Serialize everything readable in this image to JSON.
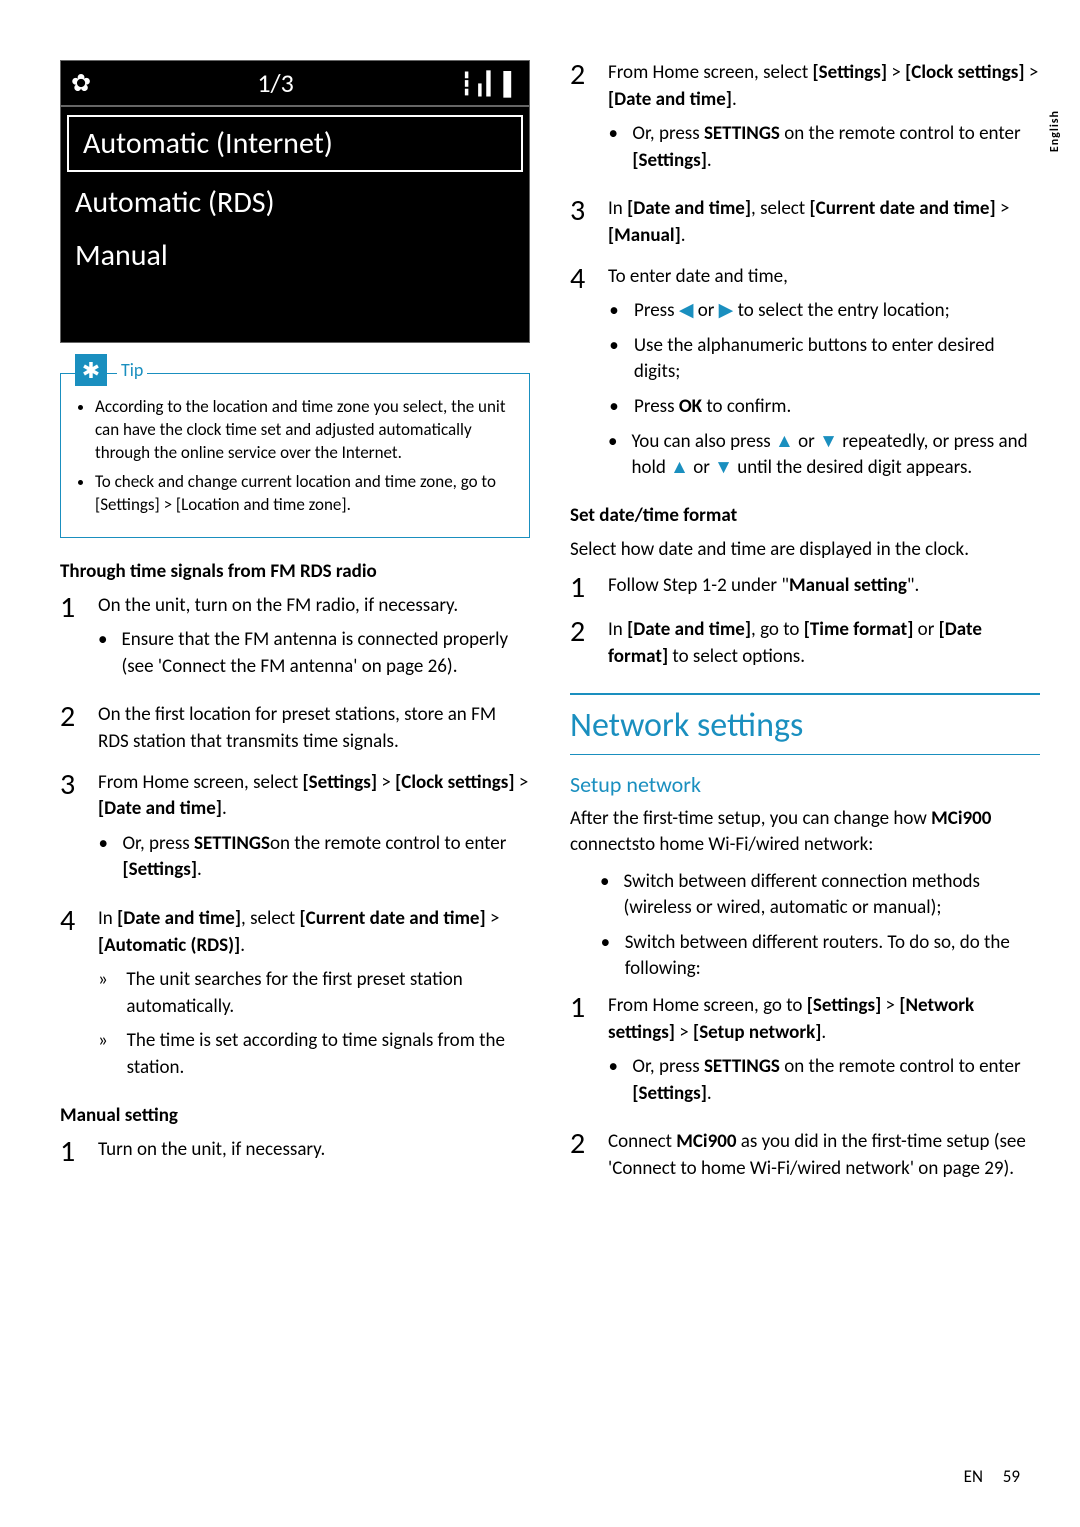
{
  "device": {
    "counter": "1/3",
    "items": [
      "Automatic (Internet)",
      "Automatic (RDS)",
      "Manual"
    ]
  },
  "tip": {
    "label": "Tip",
    "items": [
      "According to the location and time zone you select, the unit can have the clock time set and adjusted automatically through the online service over the Internet.",
      "To check and change current location and time zone, go to [Settings] > [Location and time zone]."
    ]
  },
  "left": {
    "rds_heading": "Through time signals from FM RDS radio",
    "rds_steps": {
      "s1": "On the unit, turn on the FM radio, if necessary.",
      "s1_sub": "Ensure that the FM antenna is connected properly  (see 'Connect the FM antenna' on page 26).",
      "s2": "On the first location for preset stations, store an FM RDS station that transmits time signals.",
      "s3_a": "From Home screen, select ",
      "s3_b": "[Settings]",
      "s3_c": " > ",
      "s3_d": "[Clock settings]",
      "s3_e": " > ",
      "s3_f": "[Date and time]",
      "s3_g": ".",
      "s3_sub_a": "Or, press ",
      "s3_sub_b": "SETTINGS",
      "s3_sub_c": "on the remote control to enter ",
      "s3_sub_d": "[Settings]",
      "s3_sub_e": ".",
      "s4_a": "In ",
      "s4_b": "[Date and time]",
      "s4_c": ", select ",
      "s4_d": "[Current date and time]",
      "s4_e": " > ",
      "s4_f": "[Automatic (RDS)]",
      "s4_g": ".",
      "s4_r1": "The unit searches for the first preset station automatically.",
      "s4_r2": "The time is set according to time signals from the station."
    },
    "manual_heading": "Manual setting",
    "manual_s1": "Turn on the unit, if necessary."
  },
  "right": {
    "s2_a": "From Home screen, select ",
    "s2_b": "[Settings]",
    "s2_c": " > ",
    "s2_d": "[Clock settings]",
    "s2_e": " >",
    "s2_f": "[Date and time]",
    "s2_g": ".",
    "s2_sub_a": "Or, press ",
    "s2_sub_b": "SETTINGS",
    "s2_sub_c": " on the remote control to enter ",
    "s2_sub_d": "[Settings]",
    "s2_sub_e": ".",
    "s3_a": "In ",
    "s3_b": "[Date and time]",
    "s3_c": ", select ",
    "s3_d": "[Current date and time]",
    "s3_e": " > ",
    "s3_f": "[Manual]",
    "s3_g": ".",
    "s4": "To enter date and time,",
    "s4_b1_a": "Press ",
    "s4_b1_b": " or ",
    "s4_b1_c": " to select the entry location;",
    "s4_b2": "Use the alphanumeric buttons to enter desired digits;",
    "s4_b3_a": "Press ",
    "s4_b3_b": "OK",
    "s4_b3_c": " to confirm.",
    "s4_b4_a": "You can also press ",
    "s4_b4_b": " or ",
    "s4_b4_c": " repeatedly, or press and hold ",
    "s4_b4_d": " or ",
    "s4_b4_e": " until the desired digit appears.",
    "fmt_heading": "Set date/time format",
    "fmt_para": "Select how date and time are displayed in the clock.",
    "fmt_s1_a": "Follow Step 1-2 under \"",
    "fmt_s1_b": "Manual setting",
    "fmt_s1_c": "\".",
    "fmt_s2_a": "In ",
    "fmt_s2_b": "[Date and time]",
    "fmt_s2_c": ", go to ",
    "fmt_s2_d": "[Time format]",
    "fmt_s2_e": " or ",
    "fmt_s2_f": "[Date format]",
    "fmt_s2_g": " to select options.",
    "net_heading": "Network settings",
    "net_sub": "Setup network",
    "net_para_a": "After the first-time setup, you can change how ",
    "net_para_b": "MCi900",
    "net_para_c": " connectsto home Wi-Fi/wired network:",
    "net_b1": "Switch between different connection methods (wireless or wired, automatic or manual);",
    "net_b2": "Switch between different routers. To do so, do the following:",
    "net_s1_a": "From Home screen, go to ",
    "net_s1_b": "[Settings]",
    "net_s1_c": " > ",
    "net_s1_d": "[Network settings]",
    "net_s1_e": " > ",
    "net_s1_f": "[Setup network]",
    "net_s1_g": ".",
    "net_s1_sub_a": "Or, press ",
    "net_s1_sub_b": "SETTINGS",
    "net_s1_sub_c": " on the remote control to enter ",
    "net_s1_sub_d": "[Settings]",
    "net_s1_sub_e": ".",
    "net_s2_a": "Connect ",
    "net_s2_b": "MCi900",
    "net_s2_c": " as you did in the first-time setup (see 'Connect to home Wi-Fi/wired network' on page 29)."
  },
  "lang": "English",
  "footer": {
    "lang": "EN",
    "page": "59"
  }
}
